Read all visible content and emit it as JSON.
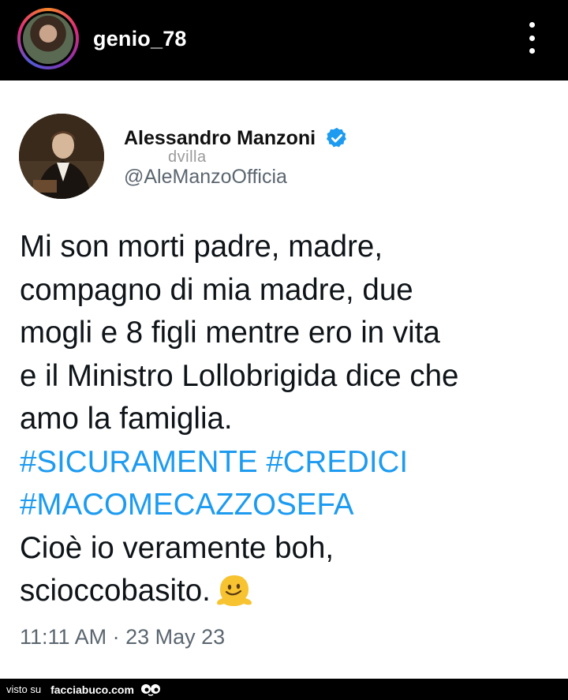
{
  "instagram": {
    "username": "genio_78"
  },
  "tweet": {
    "author_name": "Alessandro Manzoni",
    "author_handle": "@AleManzoOfficia",
    "overlay_watermark": "dvilla",
    "text_lines": [
      "Mi son morti padre, madre,",
      "compagno di mia madre, due",
      "mogli e 8 figli mentre ero in vita",
      "e il Ministro Lollobrigida dice che",
      "amo la famiglia."
    ],
    "hashtags": [
      "#SICURAMENTE",
      "#CREDICI",
      "#MACOMECAZZOSEFA"
    ],
    "closing_lines": [
      "Cioè io veramente boh,",
      "scioccobasito."
    ],
    "timestamp": "11:11 AM · 23 May 23"
  },
  "footer": {
    "label": "visto su",
    "site": "facciabuco.com"
  },
  "colors": {
    "hashtag": "#1d9bf0",
    "verified": "#1d9bf0",
    "handle_gray": "#5b6670"
  },
  "icons": [
    "more-options-icon",
    "verified-badge-icon",
    "melting-face-emoji",
    "facciabuco-logo"
  ]
}
